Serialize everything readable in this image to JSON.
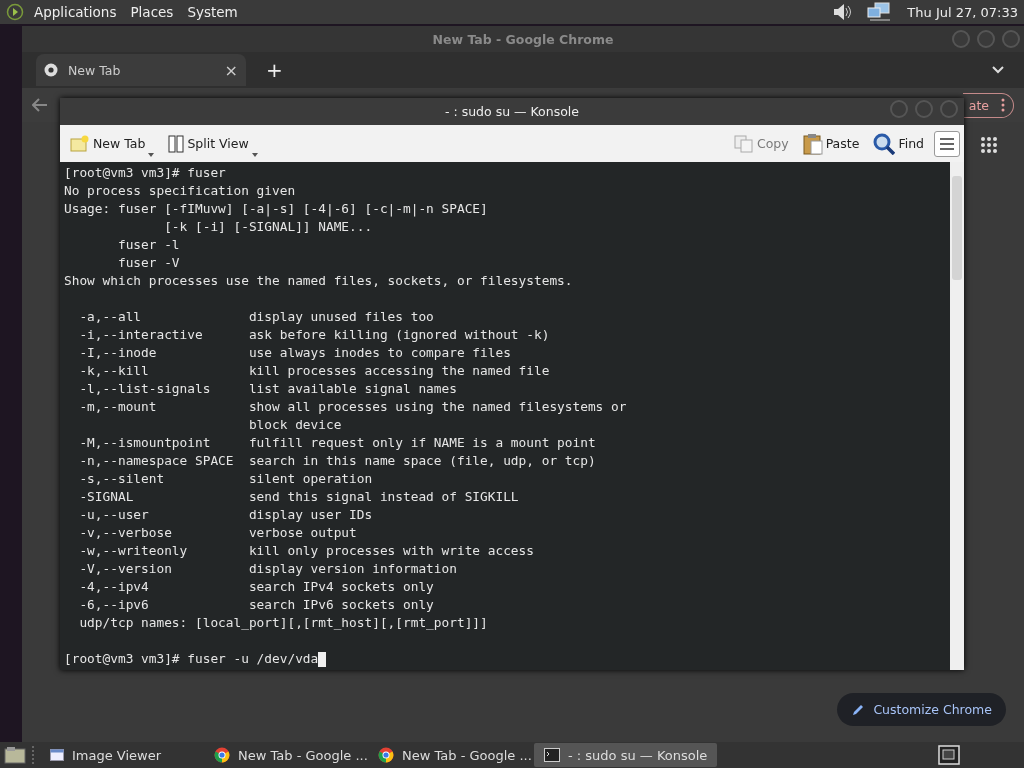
{
  "top_panel": {
    "menus": [
      "Applications",
      "Places",
      "System"
    ],
    "clock": "Thu Jul 27, 07:33"
  },
  "chrome_window": {
    "title": "New Tab - Google Chrome",
    "tabs": [
      {
        "label": "New Tab",
        "close": "×",
        "selected": true
      }
    ],
    "new_tab": "+",
    "update_button": "ate",
    "customize_button": "Customize Chrome"
  },
  "konsole_window": {
    "title": "- : sudo su — Konsole",
    "toolbar": [
      {
        "label": "New Tab",
        "kind": "new-tab",
        "disabled": false
      },
      {
        "label": "Split View",
        "kind": "split",
        "disabled": false
      },
      {
        "label": "Copy",
        "kind": "copy",
        "disabled": true
      },
      {
        "label": "Paste",
        "kind": "paste",
        "disabled": false
      },
      {
        "label": "Find",
        "kind": "find",
        "disabled": false
      }
    ],
    "terminal": {
      "blocks": [
        [
          "[root@vm3 vm3]# fuser",
          "No process specification given",
          "Usage: fuser [-fIMuvw] [-a|-s] [-4|-6] [-c|-m|-n SPACE]",
          "             [-k [-i] [-SIGNAL]] NAME...",
          "       fuser -l",
          "       fuser -V",
          "Show which processes use the named files, sockets, or filesystems."
        ],
        [
          "  -a,--all              display unused files too",
          "  -i,--interactive      ask before killing (ignored without -k)",
          "  -I,--inode            use always inodes to compare files",
          "  -k,--kill             kill processes accessing the named file",
          "  -l,--list-signals     list available signal names",
          "  -m,--mount            show all processes using the named filesystems or",
          "                        block device",
          "  -M,--ismountpoint     fulfill request only if NAME is a mount point",
          "  -n,--namespace SPACE  search in this name space (file, udp, or tcp)",
          "  -s,--silent           silent operation",
          "  -SIGNAL               send this signal instead of SIGKILL",
          "  -u,--user             display user IDs",
          "  -v,--verbose          verbose output",
          "  -w,--writeonly        kill only processes with write access",
          "  -V,--version          display version information",
          "  -4,--ipv4             search IPv4 sockets only",
          "  -6,--ipv6             search IPv6 sockets only",
          "  udp/tcp names: [local_port][,[rmt_host][,[rmt_port]]]"
        ]
      ],
      "prompt": "[root@vm3 vm3]# fuser -u /dev/vda"
    }
  },
  "taskbar": {
    "items": [
      {
        "label": "Image Viewer",
        "kind": "viewer",
        "selected": false
      },
      {
        "label": "New Tab - Google ...",
        "kind": "chrome",
        "selected": false
      },
      {
        "label": "New Tab - Google ...",
        "kind": "chrome",
        "selected": false
      },
      {
        "label": "- : sudo su — Konsole",
        "kind": "terminal",
        "selected": true
      }
    ]
  }
}
